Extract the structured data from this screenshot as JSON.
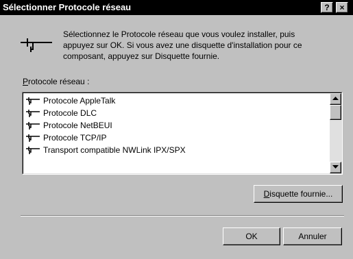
{
  "window": {
    "title": "Sélectionner Protocole réseau",
    "help_label": "?",
    "close_label": "×"
  },
  "description": {
    "lines": [
      "Sélectionnez le Protocole réseau que vous voulez installer, puis",
      "appuyez sur OK. Si vous avez une disquette d'installation pour ce",
      "composant, appuyez sur Disquette fournie."
    ]
  },
  "list": {
    "label_accel": "P",
    "label_rest": "rotocole réseau :",
    "items": [
      "Protocole AppleTalk",
      "Protocole DLC",
      "Protocole NetBEUI",
      "Protocole TCP/IP",
      "Transport compatible NWLink IPX/SPX"
    ]
  },
  "buttons": {
    "disk_accel": "D",
    "disk_rest": "isquette fournie...",
    "ok": "OK",
    "cancel": "Annuler"
  },
  "colors": {
    "face": "#c0c0c0",
    "titlebar": "#000000"
  }
}
